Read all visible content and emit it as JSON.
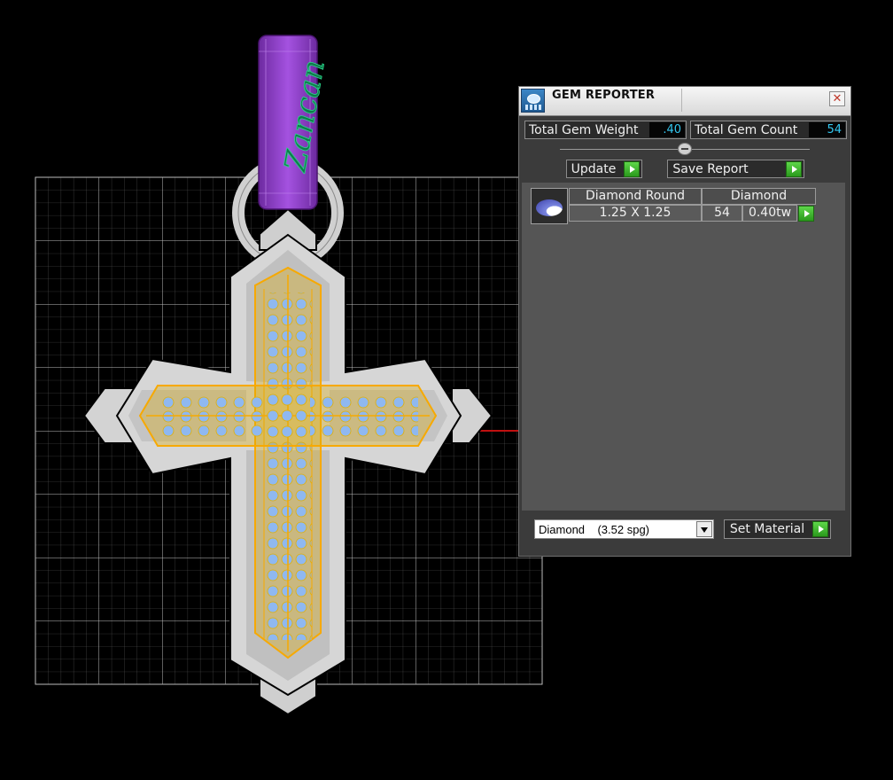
{
  "viewport": {
    "engraving_text": "Zancan",
    "colors": {
      "background": "#000000",
      "grid": "#9a9a9a",
      "metal": "#c8c8c8",
      "selection_outline": "#f7a900",
      "gems": "#8fb8f0",
      "bail": "#8b3fc2",
      "engraving": "#19a86a",
      "axis_line": "#c01010"
    }
  },
  "gem_reporter": {
    "title": "GEM REPORTER",
    "close_symbol": "✕",
    "total_gem_weight_label": "Total Gem Weight",
    "total_gem_weight_value": ".40",
    "total_gem_count_label": "Total Gem Count",
    "total_gem_count_value": "54",
    "update_label": "Update",
    "save_report_label": "Save Report",
    "gems": [
      {
        "shape": "Diamond Round",
        "material": "Diamond",
        "size": "1.25 X 1.25",
        "count": "54",
        "weight": "0.40tw"
      }
    ],
    "material_select": "Diamond    (3.52 spg)",
    "set_material_label": "Set Material"
  }
}
